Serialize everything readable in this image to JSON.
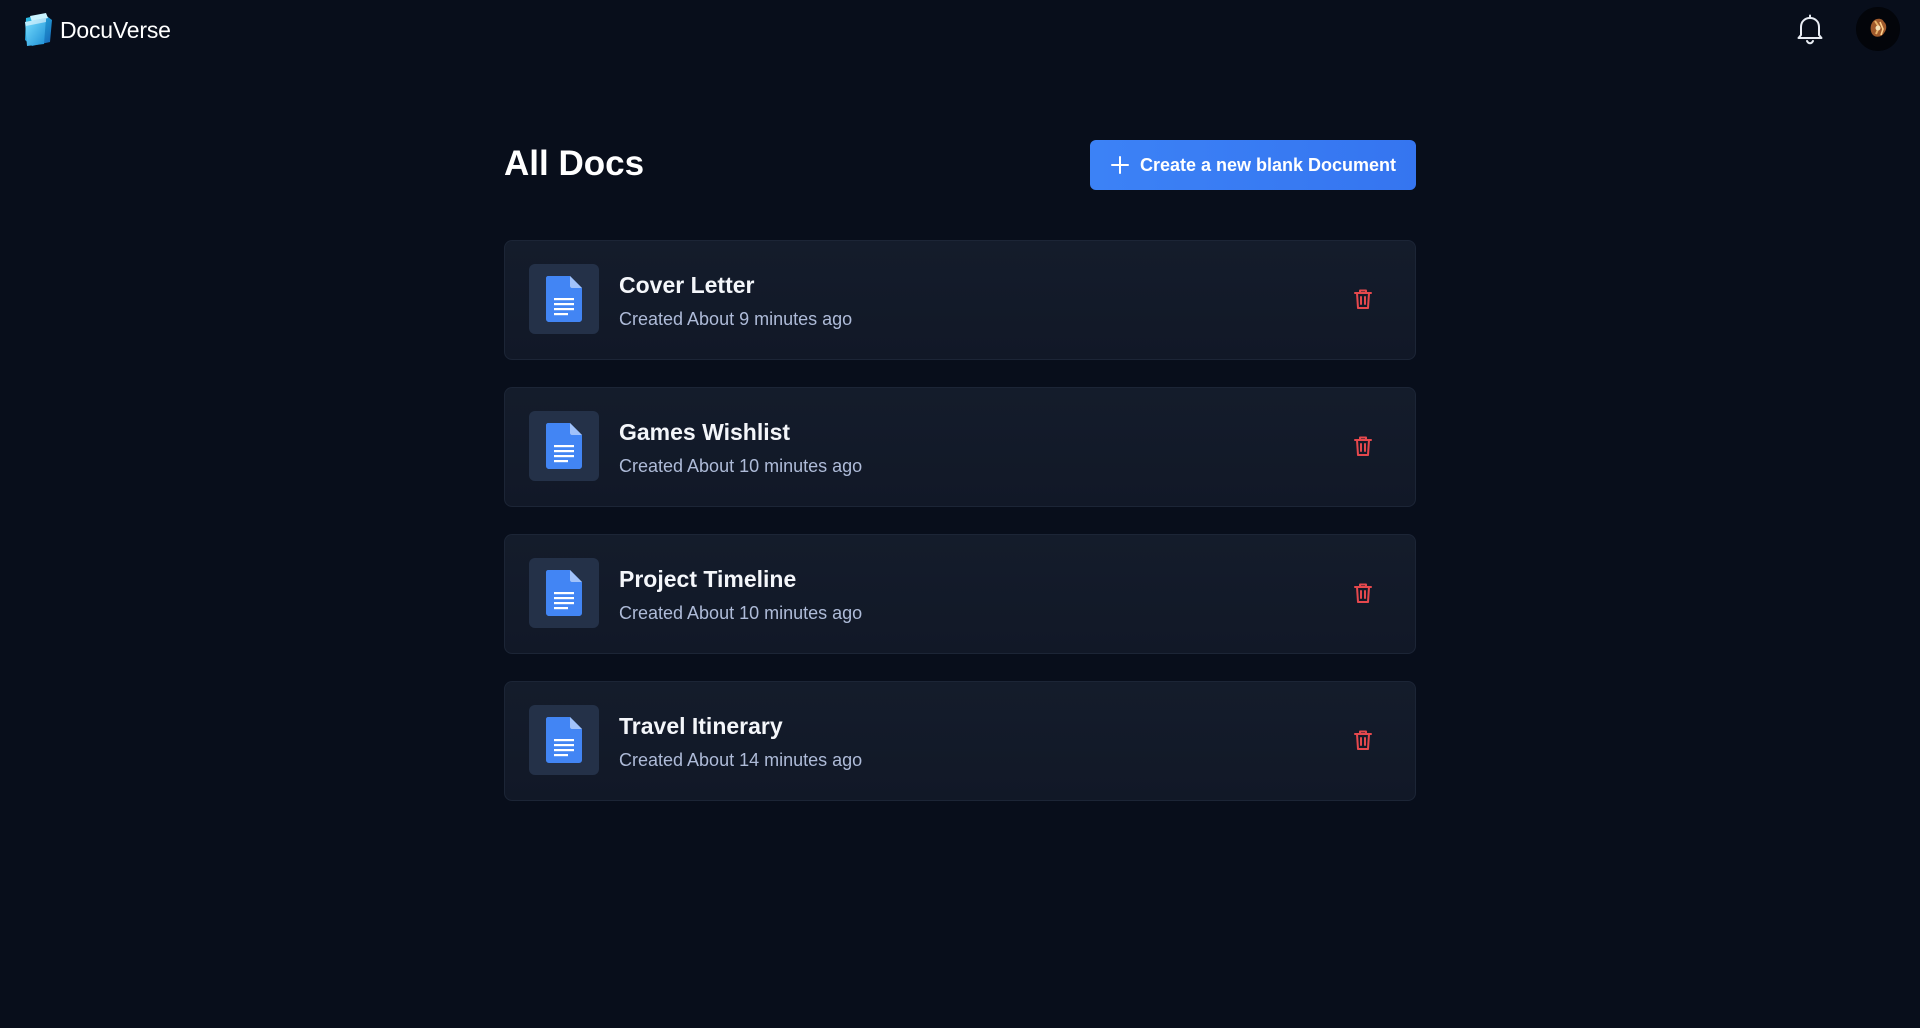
{
  "app": {
    "name": "DocuVerse"
  },
  "header": {
    "logo_icon": "folder-logo-icon",
    "notification_icon": "bell-icon",
    "avatar_icon": "user-avatar"
  },
  "page": {
    "title": "All Docs",
    "create_button_label": "Create a new blank Document",
    "create_button_icon": "plus-icon"
  },
  "documents": [
    {
      "title": "Cover Letter",
      "created": "Created About 9 minutes ago"
    },
    {
      "title": "Games Wishlist",
      "created": "Created About 10 minutes ago"
    },
    {
      "title": "Project Timeline",
      "created": "Created About 10 minutes ago"
    },
    {
      "title": "Travel Itinerary",
      "created": "Created About 14 minutes ago"
    }
  ],
  "colors": {
    "background": "#080e1b",
    "card": "#141c2b",
    "accent": "#3c82f6",
    "danger": "#e5484d",
    "muted_text": "#aebbd8"
  }
}
